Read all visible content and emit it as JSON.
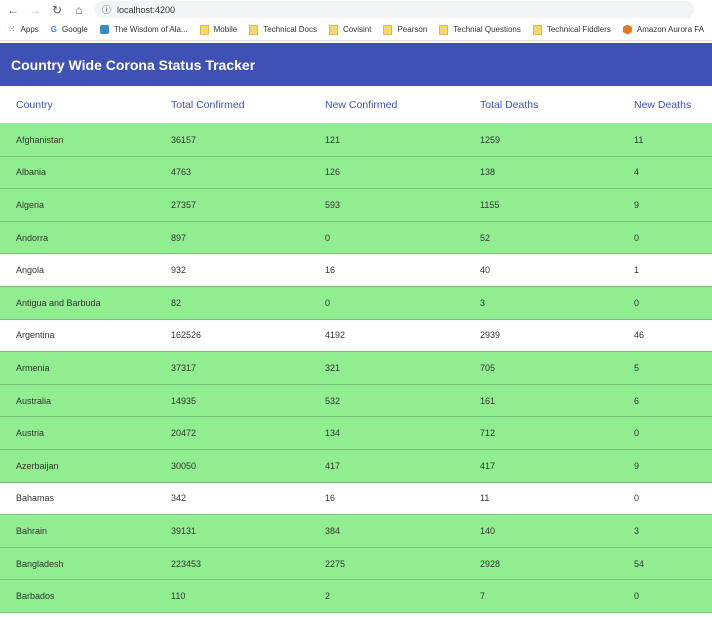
{
  "browser": {
    "url": "localhost:4200",
    "bookmarks": [
      "Apps",
      "Google",
      "The Wisdom of Ala...",
      "Mobile",
      "Technical Docs",
      "Covisint",
      "Pearson",
      "Technial Questions",
      "Technical Fiddlers",
      "Amazon Aurora FA"
    ]
  },
  "header": {
    "title": "Country Wide Corona Status Tracker",
    "accent": "#3f51b5"
  },
  "table": {
    "columns": [
      "Country",
      "Total Confirmed",
      "New Confirmed",
      "Total Deaths",
      "New Deaths"
    ],
    "highlight_color": "#90ee90",
    "rows": [
      {
        "cells": [
          "Afghanistan",
          "36157",
          "121",
          "1259",
          "11"
        ],
        "highlighted": true
      },
      {
        "cells": [
          "Albania",
          "4763",
          "126",
          "138",
          "4"
        ],
        "highlighted": true
      },
      {
        "cells": [
          "Algeria",
          "27357",
          "593",
          "1155",
          "9"
        ],
        "highlighted": true
      },
      {
        "cells": [
          "Andorra",
          "897",
          "0",
          "52",
          "0"
        ],
        "highlighted": true
      },
      {
        "cells": [
          "Angola",
          "932",
          "16",
          "40",
          "1"
        ],
        "highlighted": false
      },
      {
        "cells": [
          "Antigua and Barbuda",
          "82",
          "0",
          "3",
          "0"
        ],
        "highlighted": true
      },
      {
        "cells": [
          "Argentina",
          "162526",
          "4192",
          "2939",
          "46"
        ],
        "highlighted": false
      },
      {
        "cells": [
          "Armenia",
          "37317",
          "321",
          "705",
          "5"
        ],
        "highlighted": true
      },
      {
        "cells": [
          "Australia",
          "14935",
          "532",
          "161",
          "6"
        ],
        "highlighted": true
      },
      {
        "cells": [
          "Austria",
          "20472",
          "134",
          "712",
          "0"
        ],
        "highlighted": true
      },
      {
        "cells": [
          "Azerbaijan",
          "30050",
          "417",
          "417",
          "9"
        ],
        "highlighted": true
      },
      {
        "cells": [
          "Bahamas",
          "342",
          "16",
          "11",
          "0"
        ],
        "highlighted": false
      },
      {
        "cells": [
          "Bahrain",
          "39131",
          "384",
          "140",
          "3"
        ],
        "highlighted": true
      },
      {
        "cells": [
          "Bangladesh",
          "223453",
          "2275",
          "2928",
          "54"
        ],
        "highlighted": true
      },
      {
        "cells": [
          "Barbados",
          "110",
          "2",
          "7",
          "0"
        ],
        "highlighted": true
      }
    ]
  }
}
